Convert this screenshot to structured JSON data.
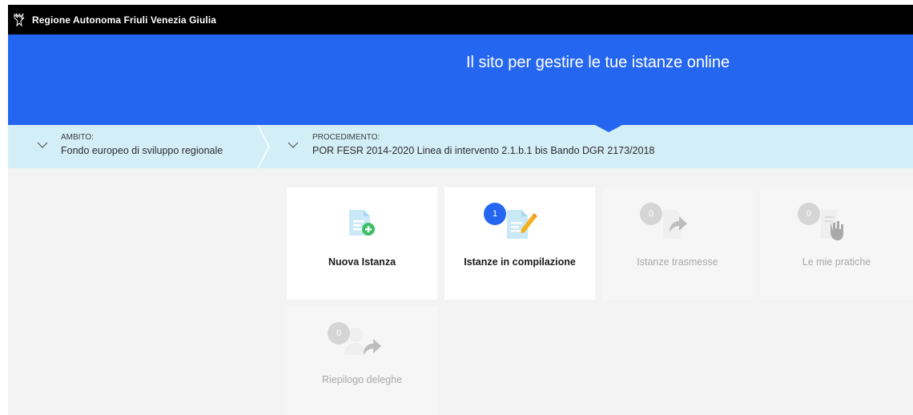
{
  "header": {
    "org_name": "Regione Autonoma Friuli Venezia Giulia",
    "logo_icon": "eagle-logo-icon"
  },
  "hero": {
    "title": "Il sito per gestire le tue istanze online"
  },
  "selectors": {
    "ambito": {
      "label": "AMBITO:",
      "value": "Fondo europeo di sviluppo regionale"
    },
    "procedimento": {
      "label": "PROCEDIMENTO:",
      "value": "POR FESR 2014-2020 Linea di intervento 2.1.b.1 bis Bando DGR 2173/2018"
    }
  },
  "tiles": [
    {
      "label": "Nuova Istanza",
      "icon": "new-document-icon",
      "enabled": true
    },
    {
      "label": "Istanze in compilazione",
      "icon": "document-edit-icon",
      "count": "1",
      "enabled": true
    },
    {
      "label": "Istanze trasmesse",
      "icon": "document-forward-icon",
      "count": "0",
      "enabled": false
    },
    {
      "label": "Le mie pratiche",
      "icon": "document-hand-icon",
      "count": "0",
      "enabled": false
    },
    {
      "label": "Riepilogo deleghe",
      "icon": "delegation-icon",
      "count": "0",
      "enabled": false
    }
  ],
  "colors": {
    "brand_blue": "#2566f0",
    "strip": "#d4eef8",
    "accent_green": "#3ec063",
    "accent_yellow": "#f2b01e"
  }
}
